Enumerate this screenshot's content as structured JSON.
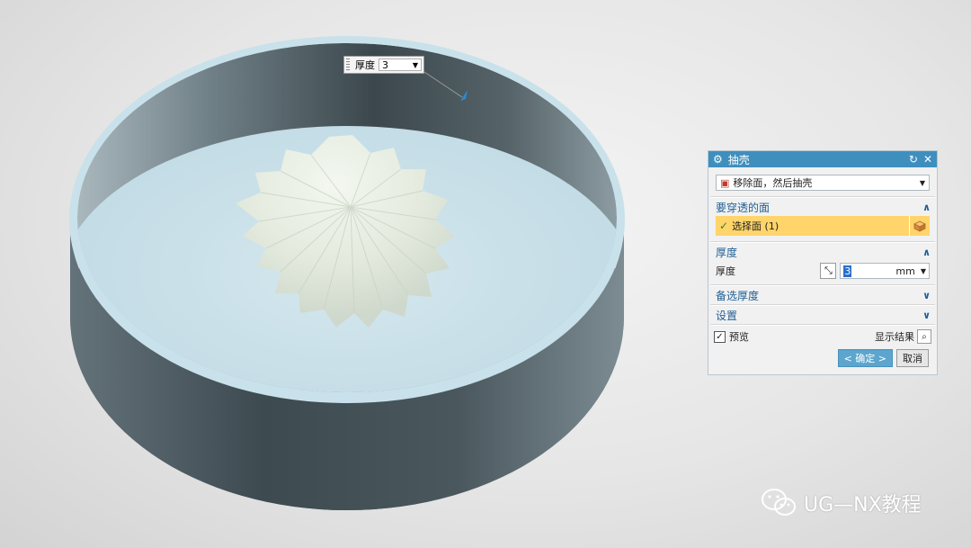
{
  "colors": {
    "accent": "#3f8fbe",
    "highlight": "#ffd46a",
    "section_text": "#1f5f96"
  },
  "dynamic_input": {
    "label": "厚度",
    "value": "3"
  },
  "dialog": {
    "title": "抽壳",
    "type_option": "移除面，然后抽壳",
    "faces_section": {
      "title": "要穿透的面",
      "select_label": "选择面 (1)"
    },
    "thickness_section": {
      "title": "厚度",
      "label": "厚度",
      "value": "3",
      "unit": "mm"
    },
    "alt_thickness_section": {
      "title": "备选厚度"
    },
    "settings_section": {
      "title": "设置"
    },
    "preview_label": "预览",
    "show_result_label": "显示结果",
    "ok_label": "< 确定 >",
    "cancel_label": "取消"
  },
  "watermark": {
    "text": "UG—NX教程"
  }
}
